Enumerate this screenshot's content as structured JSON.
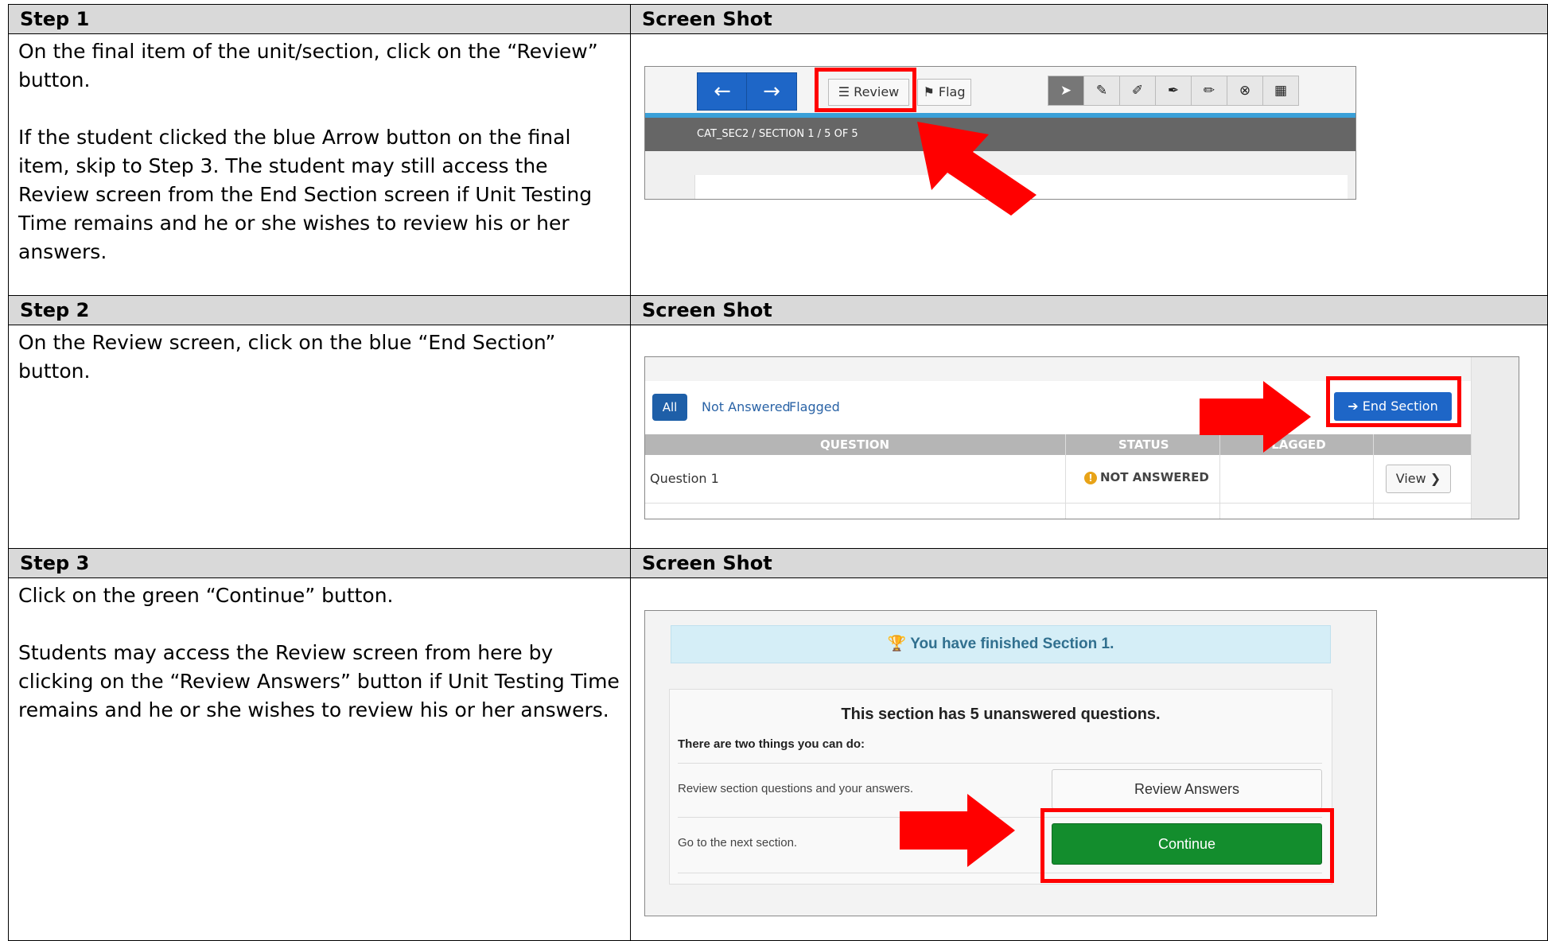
{
  "rows": [
    {
      "step_label": "Step 1",
      "shot_label": "Screen Shot",
      "paragraphs": [
        "On the final item of the unit/section, click on the “Review” button.",
        "If the student clicked the blue Arrow button on the final item, skip to Step 3. The student may still access the Review screen from the End Section screen if Unit Testing Time remains and he or she wishes to review his or her answers."
      ]
    },
    {
      "step_label": "Step 2",
      "shot_label": "Screen Shot",
      "paragraphs": [
        "On the Review screen, click on the blue “End Section” button."
      ]
    },
    {
      "step_label": "Step 3",
      "shot_label": "Screen Shot",
      "paragraphs": [
        "Click on the green “Continue” button.",
        "Students may access the Review screen from here by clicking on the “Review Answers” button if Unit Testing Time remains and he or she wishes to review his or her answers."
      ]
    }
  ],
  "shot1": {
    "back_arrow": "←",
    "forward_arrow": "→",
    "review_label": "Review",
    "flag_label": "Flag",
    "breadcrumb": "CAT_SEC2   /   SECTION 1   /   5 OF 5",
    "tool_icons": [
      "pointer-icon",
      "pencil-icon",
      "highlighter-icon",
      "marker-icon",
      "eraser-icon",
      "clear-icon",
      "calculator-icon"
    ],
    "highlight_color": "#ff0000"
  },
  "shot2": {
    "tab_all": "All",
    "tab_not_answered": "Not Answered",
    "tab_flagged": "Flagged",
    "end_section_label": "End Section",
    "col_question": "QUESTION",
    "col_status": "STATUS",
    "col_flagged": "FLAGGED",
    "row_question": "Question 1",
    "row_status": "NOT ANSWERED",
    "view_label": "View",
    "accent": "#1e66c7"
  },
  "shot3": {
    "banner": "You have finished Section 1.",
    "title": "This section has 5 unanswered questions.",
    "subtitle": "There are two things you can do:",
    "option1_text": "Review section questions and your answers.",
    "option1_button": "Review Answers",
    "option2_text": "Go to the next section.",
    "option2_button": "Continue",
    "continue_color": "#138d2d"
  }
}
